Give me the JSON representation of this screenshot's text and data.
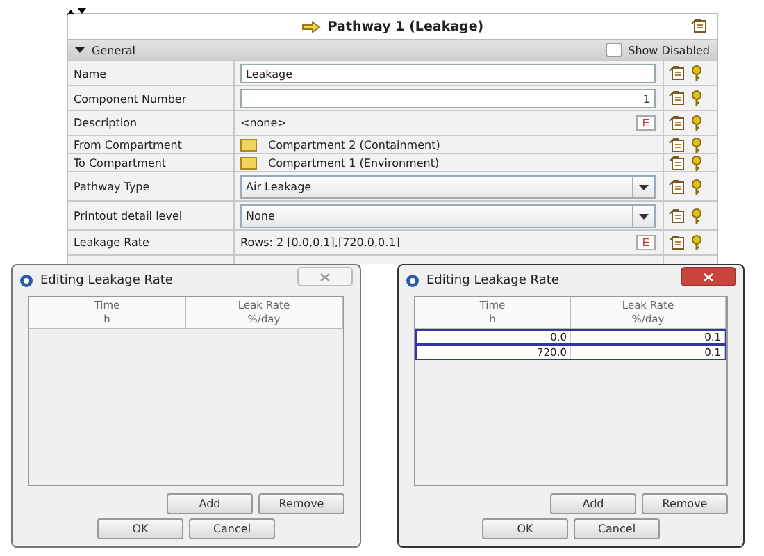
{
  "panel": {
    "title": "Pathway 1 (Leakage)",
    "section": {
      "label": "General",
      "expanded": true
    },
    "show_disabled": {
      "label": "Show Disabled",
      "checked": false
    },
    "rows": [
      {
        "label": "Name",
        "kind": "text",
        "value": "Leakage"
      },
      {
        "label": "Component Number",
        "kind": "number",
        "value": "1"
      },
      {
        "label": "Description",
        "kind": "editor",
        "value": "<none>",
        "button": "E"
      },
      {
        "label": "From Compartment",
        "kind": "compartment",
        "value": "Compartment 2 (Containment)"
      },
      {
        "label": "To Compartment",
        "kind": "compartment",
        "value": "Compartment 1 (Environment)"
      },
      {
        "label": "Pathway Type",
        "kind": "dropdown",
        "value": "Air Leakage"
      },
      {
        "label": "Printout detail level",
        "kind": "dropdown",
        "value": "None"
      },
      {
        "label": "Leakage Rate",
        "kind": "editor",
        "value": "Rows: 2 [0.0,0.1],[720.0,0.1]",
        "button": "E"
      }
    ]
  },
  "dialogs": [
    {
      "title": "Editing Leakage Rate",
      "active": false,
      "columns": [
        {
          "label": "Time",
          "unit": "h"
        },
        {
          "label": "Leak Rate",
          "unit": "%/day"
        }
      ],
      "buttons": [
        "Add",
        "Remove"
      ],
      "footer_buttons": [
        "OK",
        "Cancel"
      ]
    },
    {
      "title": "Editing Leakage Rate",
      "active": true,
      "columns": [
        {
          "label": "Time",
          "unit": "h"
        },
        {
          "label": "Leak Rate",
          "unit": "%/day"
        }
      ],
      "rows": [
        {
          "cells": [
            "0.0",
            "0.1"
          ],
          "selected": true
        },
        {
          "cells": [
            "720.0",
            "0.1"
          ],
          "selected": true
        }
      ],
      "buttons": [
        "Add",
        "Remove"
      ],
      "footer_buttons": [
        "OK",
        "Cancel"
      ]
    }
  ]
}
